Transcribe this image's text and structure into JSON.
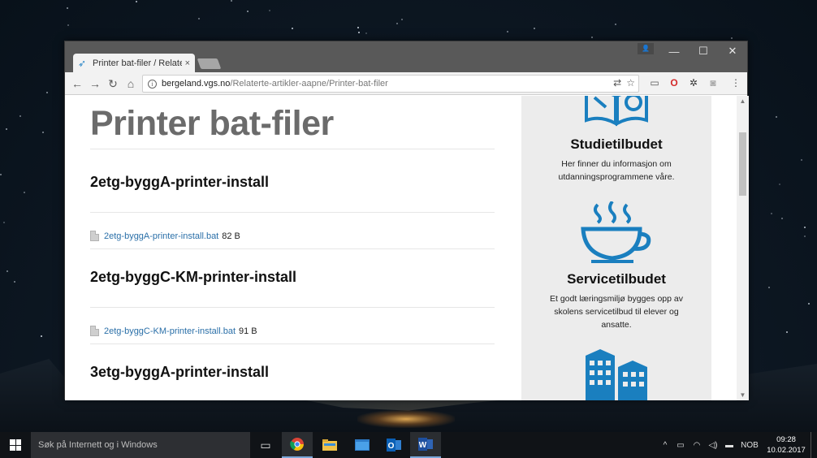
{
  "browser": {
    "tab": {
      "title": "Printer bat-filer / Relaterte",
      "close": "×"
    },
    "window_controls": {
      "minimize": "—",
      "maximize": "☐",
      "close": "✕"
    },
    "url": {
      "host": "bergeland.vgs.no",
      "path": "/Relaterte-artikler-aapne/Printer-bat-filer"
    }
  },
  "page": {
    "title": "Printer bat-filer",
    "files": [
      {
        "heading": "2etg-byggA-printer-install",
        "link": "2etg-byggA-printer-install.bat",
        "size": "82 B"
      },
      {
        "heading": "2etg-byggC-KM-printer-install",
        "link": "2etg-byggC-KM-printer-install.bat",
        "size": "91 B"
      },
      {
        "heading": "3etg-byggA-printer-install"
      }
    ]
  },
  "sidebar": {
    "studie": {
      "title": "Studietilbudet",
      "text": "Her finner du informasjon om utdanningsprogrammene våre."
    },
    "service": {
      "title": "Servicetilbudet",
      "text": "Et godt læringsmiljø bygges opp av skolens servicetilbud til elever og ansatte."
    }
  },
  "taskbar": {
    "search_placeholder": "Søk på Internett og i Windows",
    "language": "NOB",
    "time": "09:28",
    "date": "10.02.2017"
  },
  "colors": {
    "accent_blue": "#1a7fbf",
    "link": "#2a6fa8"
  }
}
